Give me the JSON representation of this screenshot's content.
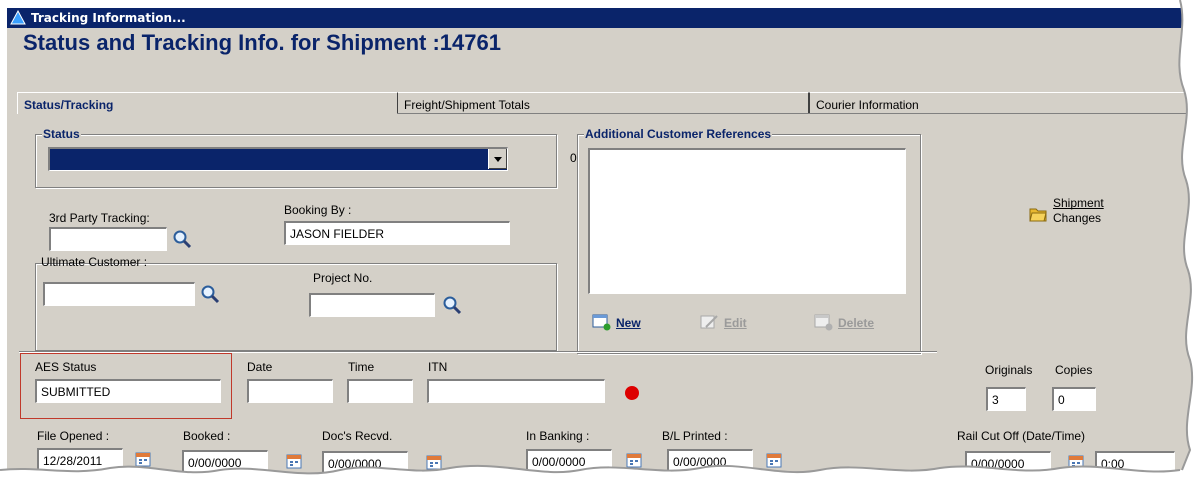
{
  "window": {
    "title": "Tracking Information..."
  },
  "heading": "Status and Tracking Info. for Shipment :14761",
  "tabs": [
    {
      "label": "Status/Tracking"
    },
    {
      "label": "Freight/Shipment Totals"
    },
    {
      "label": "Courier Information"
    }
  ],
  "status_group": {
    "label": "Status",
    "count": "0",
    "selected": ""
  },
  "third_party": {
    "label": "3rd Party Tracking:",
    "value": ""
  },
  "booking_by": {
    "label": "Booking By :",
    "value": "JASON FIELDER"
  },
  "ultimate_customer": {
    "label": "Ultimate Customer :",
    "value": ""
  },
  "project_no": {
    "label": "Project No.",
    "value": ""
  },
  "refs_group": {
    "label": "Additional Customer References",
    "new_label": "New",
    "edit_label": "Edit",
    "delete_label": "Delete"
  },
  "shipment_changes": {
    "line1": "Shipment",
    "line2": "Changes"
  },
  "aes": {
    "status_label": "AES Status",
    "status_value": "SUBMITTED",
    "date_label": "Date",
    "date_value": "",
    "time_label": "Time",
    "time_value": "",
    "itn_label": "ITN",
    "itn_value": "",
    "indicator_color": "#dd0000"
  },
  "originals": {
    "label": "Originals",
    "value": "3"
  },
  "copies": {
    "label": "Copies",
    "value": "0"
  },
  "dates": {
    "file_opened": {
      "label": "File Opened :",
      "value": "12/28/2011"
    },
    "booked": {
      "label": "Booked :",
      "value": "0/00/0000"
    },
    "docs_recvd": {
      "label": "Doc's Recvd.",
      "value": "0/00/0000"
    },
    "in_banking": {
      "label": "In Banking :",
      "value": "0/00/0000"
    },
    "bl_printed": {
      "label": "B/L Printed :",
      "value": "0/00/0000"
    },
    "rail_cut_off": {
      "label": "Rail Cut Off (Date/Time)",
      "date_value": "0/00/0000",
      "time_value": "0:00"
    }
  },
  "colors": {
    "titlebar": "#0a246a",
    "heading": "#0a246a",
    "highlight_box": "#c0392b",
    "window_bg": "#d4d0c8"
  }
}
